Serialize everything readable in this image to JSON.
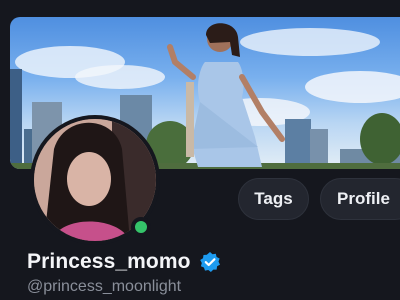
{
  "profile": {
    "display_name": "Princess_momo",
    "handle": "@princess_moonlight",
    "verified_icon": "verified-badge-icon",
    "online_status": "online"
  },
  "actions": {
    "tags_label": "Tags",
    "profile_label": "Profile"
  },
  "colors": {
    "background": "#15171e",
    "button_bg": "#23262f",
    "verified_blue": "#1d9bf0",
    "online_green": "#35c46a",
    "handle_gray": "#8a8f9a"
  }
}
